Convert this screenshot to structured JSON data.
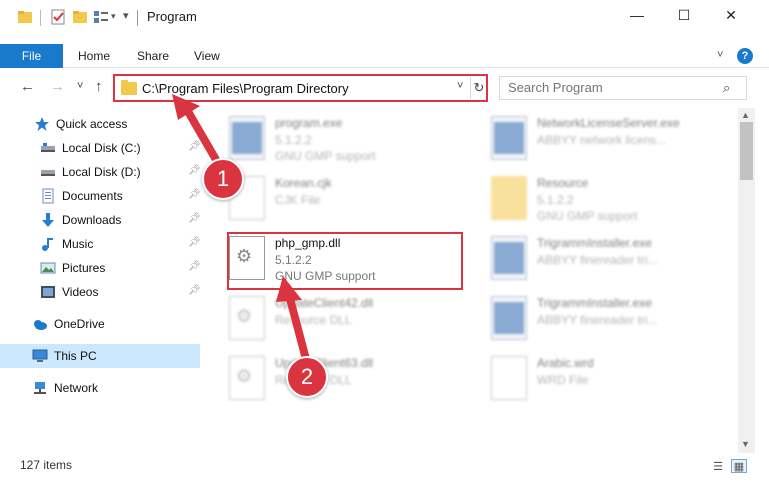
{
  "window": {
    "title": "Program",
    "minimize": "—",
    "maximize": "☐",
    "close": "✕"
  },
  "ribbon": {
    "file": "File",
    "tabs": [
      "Home",
      "Share",
      "View"
    ],
    "help": "?"
  },
  "nav": {
    "back": "←",
    "forward": "→",
    "recent": "˅",
    "up": "↑",
    "address": "C:\\Program Files\\Program Directory",
    "refresh": "↻",
    "search_placeholder": "Search Program"
  },
  "sidebar": {
    "items": [
      {
        "label": "Quick access",
        "icon": "star-icon"
      },
      {
        "label": "Local Disk (C:)",
        "icon": "drive-icon"
      },
      {
        "label": "Local Disk (D:)",
        "icon": "drive-icon"
      },
      {
        "label": "Documents",
        "icon": "documents-icon"
      },
      {
        "label": "Downloads",
        "icon": "download-icon"
      },
      {
        "label": "Music",
        "icon": "music-icon"
      },
      {
        "label": "Pictures",
        "icon": "pictures-icon"
      },
      {
        "label": "Videos",
        "icon": "videos-icon"
      },
      {
        "label": "OneDrive",
        "icon": "cloud-icon"
      },
      {
        "label": "This PC",
        "icon": "computer-icon"
      },
      {
        "label": "Network",
        "icon": "network-icon"
      }
    ]
  },
  "files": [
    {
      "name": "program.exe",
      "line2": "5.1.2.2",
      "line3": "GNU GMP support"
    },
    {
      "name": "NetworkLicenseServer.exe",
      "line2": "ABBYY network licens...",
      "line3": ""
    },
    {
      "name": "Korean.cjk",
      "line2": "CJK File",
      "line3": ""
    },
    {
      "name": "Resource",
      "line2": "5.1.2.2",
      "line3": "GNU GMP support"
    },
    {
      "name": "php_gmp.dll",
      "line2": "5.1.2.2",
      "line3": "GNU GMP support"
    },
    {
      "name": "TrigrammInstaller.exe",
      "line2": "ABBYY finereader tri...",
      "line3": ""
    },
    {
      "name": "UpdateClient42.dll",
      "line2": "Resource DLL",
      "line3": ""
    },
    {
      "name": "TrigrammInstaller.exe",
      "line2": "ABBYY finereader tri...",
      "line3": ""
    },
    {
      "name": "UpdateClient63.dll",
      "line2": "Resource DLL",
      "line3": ""
    },
    {
      "name": "Arabic.wrd",
      "line2": "WRD File",
      "line3": ""
    }
  ],
  "status": {
    "items": "127 items"
  },
  "callouts": [
    "1",
    "2"
  ],
  "colors": {
    "accent": "#1979ca",
    "highlight": "#d9343f",
    "selected": "#cce8ff"
  }
}
